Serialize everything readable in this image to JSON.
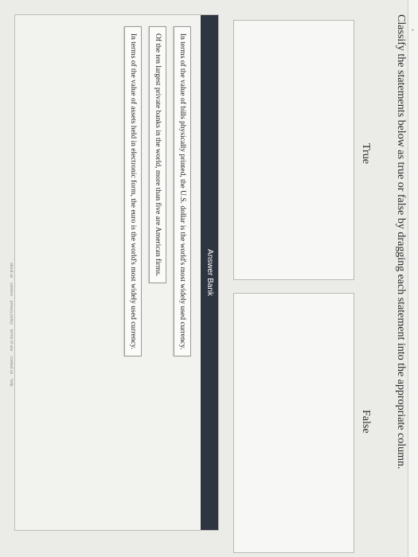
{
  "prompt": "Classify the statements below as true or false by dragging each statement into the appropriate column.",
  "columns": {
    "true_label": "True",
    "false_label": "False"
  },
  "answer_bank": {
    "title": "Answer Bank",
    "items": [
      {
        "text": "In terms of the value of bills physically printed, the U.S. dollar is the world's most widely used currency."
      },
      {
        "text": "Of the ten largest private banks in the world, more than five are American firms."
      },
      {
        "text": "In terms of the value of assets held in electronic form, the euro is the world's most widely used currency."
      }
    ]
  },
  "footer": {
    "links": [
      "about us",
      "careers",
      "privacy policy",
      "terms of use",
      "contact us",
      "help"
    ]
  },
  "icons": {
    "top_chevron": "chevron-icon"
  }
}
